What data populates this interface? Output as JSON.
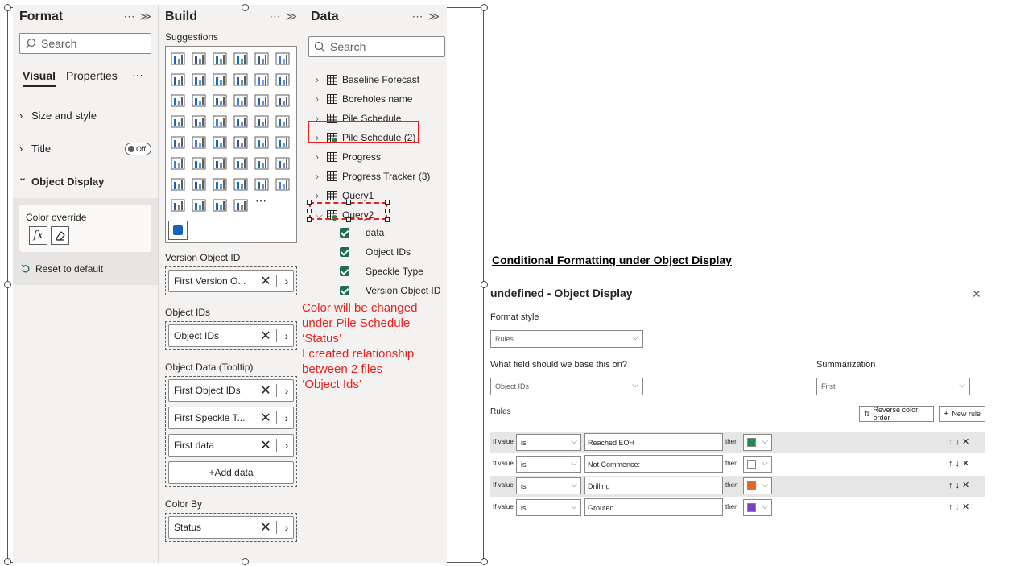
{
  "format_pane": {
    "title": "Format",
    "actions": "⋯ ≫",
    "search_placeholder": "Search",
    "tabs": [
      "Visual",
      "Properties"
    ],
    "tab_more": "⋯",
    "sections": [
      {
        "label": "Size and style"
      },
      {
        "label": "Title",
        "toggle": "Off"
      },
      {
        "label": "Object Display"
      }
    ],
    "color_override_label": "Color override",
    "reset_label": "Reset to default"
  },
  "build_pane": {
    "title": "Build",
    "actions": "⋯ ≫",
    "suggestions_label": "Suggestions",
    "viz_more": "⋯",
    "groups": [
      {
        "label": "Version Object ID",
        "fields": [
          "First Version O..."
        ]
      },
      {
        "label": "Object IDs",
        "fields": [
          "Object IDs"
        ]
      },
      {
        "label": "Object Data (Tooltip)",
        "fields": [
          "First Object IDs",
          "First Speckle T...",
          "First data"
        ],
        "add": "+Add data"
      },
      {
        "label": "Color By",
        "fields": [
          "Status"
        ]
      }
    ]
  },
  "data_pane": {
    "title": "Data",
    "actions": "⋯ ≫",
    "search_placeholder": "Search",
    "tables": [
      "Baseline Forecast",
      "Boreholes name",
      "Pile Schedule",
      "Pile Schedule (2)",
      "Progress",
      "Progress Tracker (3)",
      "Query1",
      "Query2"
    ],
    "query2_fields": [
      "data",
      "Object IDs",
      "Speckle Type",
      "Version Object ID"
    ]
  },
  "annotation": {
    "lines": [
      "Color will be changed",
      "under Pile Schedule",
      "‘Status’",
      "I created relationship",
      "between 2 files",
      "‘Object Ids’"
    ]
  },
  "cf_panel": {
    "heading": "Conditional Formatting under Object Display",
    "dialog_title": "undefined - Object Display",
    "format_style_label": "Format style",
    "format_style_value": "Rules",
    "field_label": "What field should we base this on?",
    "field_value": "Object IDs",
    "summarization_label": "Summarization",
    "summarization_value": "First",
    "rules_label": "Rules",
    "reverse_button": "Reverse color order",
    "new_rule_button": "New rule",
    "rules": [
      {
        "if": "If value",
        "op": "is",
        "value": "Reached EOH",
        "then": "then",
        "color": "#1e8a4c"
      },
      {
        "if": "If value",
        "op": "is",
        "value": "Not Commence:",
        "then": "then",
        "color": "#ffffff"
      },
      {
        "if": "If value",
        "op": "is",
        "value": "Drilling",
        "then": "then",
        "color": "#e0662a"
      },
      {
        "if": "If value",
        "op": "is",
        "value": "Grouted",
        "then": "then",
        "color": "#7b3fc2"
      }
    ]
  }
}
